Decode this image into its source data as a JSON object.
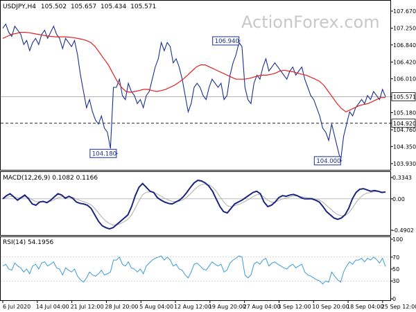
{
  "chart_data": {
    "type": "line",
    "header": {
      "symbol": "USDJPY,H4",
      "open": "105.502",
      "high": "105.657",
      "low": "105.434",
      "close": "105.571"
    },
    "watermark": "ActionForex.com",
    "colors": {
      "price": "#1a2f8f",
      "ma": "#e02020",
      "macd": "#1a237e",
      "signal": "#b0b0b0",
      "rsi": "#3a9ad9",
      "label_bg": "#ffffff",
      "label_border": "#1a2f8f",
      "grid": "#d9d9d9",
      "dash": "#222222"
    },
    "x_axis": {
      "labels": [
        "6 Jul 2020",
        "14 Jul 04:00",
        "21 Jul 12:00",
        "28 Jul 20:00",
        "5 Aug 04:00",
        "12 Aug 12:00",
        "19 Aug 20:00",
        "27 Aug 04:00",
        "3 Sep 12:00",
        "10 Sep 20:00",
        "18 Sep 04:00",
        "25 Sep 12:00"
      ],
      "label_positions": [
        0,
        12,
        24,
        36,
        48,
        60,
        72,
        84,
        96,
        108,
        120,
        132
      ]
    },
    "price_panel": {
      "ylim": [
        103.93,
        107.67
      ],
      "ticks": [
        "107.670",
        "107.250",
        "106.840",
        "106.420",
        "106.010",
        "105.571",
        "105.180",
        "104.920",
        "104.760",
        "104.350",
        "103.930"
      ],
      "tick_values": [
        107.67,
        107.25,
        106.84,
        106.42,
        106.01,
        105.571,
        105.18,
        104.92,
        104.76,
        104.35,
        103.93
      ],
      "highlight": {
        "current": "105.571",
        "level": "104.920"
      },
      "current_line": 105.571,
      "dashed_level": 104.92,
      "annotations": [
        {
          "text": "104.180",
          "x": 38,
          "y": 104.18,
          "side": "left"
        },
        {
          "text": "106.940",
          "x": 79,
          "y": 106.94,
          "side": "left"
        },
        {
          "text": "104.000",
          "x": 113,
          "y": 104.0,
          "side": "left"
        }
      ],
      "close": [
        107.25,
        107.35,
        107.15,
        107.05,
        107.3,
        107.2,
        107.1,
        106.85,
        106.95,
        106.7,
        106.9,
        107.0,
        106.85,
        107.1,
        107.2,
        107.0,
        107.15,
        107.3,
        107.1,
        107.0,
        106.75,
        107.0,
        106.9,
        106.8,
        106.95,
        106.6,
        106.1,
        105.7,
        105.3,
        105.5,
        105.2,
        105.0,
        104.9,
        105.1,
        104.8,
        104.7,
        104.3,
        105.8,
        105.8,
        106.0,
        105.6,
        105.5,
        105.9,
        105.7,
        105.6,
        105.4,
        105.5,
        105.3,
        105.6,
        105.7,
        106.0,
        106.3,
        106.5,
        106.9,
        106.7,
        106.9,
        106.8,
        106.4,
        106.5,
        106.3,
        106.0,
        105.6,
        105.2,
        105.4,
        105.8,
        105.9,
        105.8,
        105.6,
        105.5,
        105.8,
        106.0,
        105.9,
        105.8,
        105.9,
        105.5,
        105.6,
        106.1,
        106.4,
        106.6,
        106.9,
        106.8,
        105.8,
        105.5,
        105.4,
        105.9,
        106.1,
        106.0,
        106.3,
        106.5,
        106.2,
        106.3,
        106.4,
        106.3,
        106.2,
        106.1,
        106.0,
        106.2,
        106.3,
        106.1,
        106.2,
        106.3,
        106.0,
        105.8,
        105.6,
        105.5,
        105.3,
        105.1,
        104.8,
        104.7,
        104.5,
        104.9,
        104.6,
        104.3,
        104.0,
        104.6,
        104.9,
        105.2,
        105.1,
        105.3,
        105.4,
        105.5,
        105.4,
        105.6,
        105.5,
        105.7,
        105.6,
        105.5,
        105.75,
        105.571
      ],
      "ma": [
        107.0,
        107.05,
        107.1,
        107.12,
        107.15,
        107.15,
        107.14,
        107.12,
        107.1,
        107.08,
        107.06,
        107.05,
        107.04,
        107.04,
        107.04,
        107.03,
        107.02,
        107.0,
        106.98,
        106.95,
        106.9,
        106.8,
        106.65,
        106.5,
        106.35,
        106.15,
        105.95,
        105.8,
        105.7,
        105.68,
        105.7,
        105.72,
        105.75,
        105.75,
        105.72,
        105.7,
        105.72,
        105.75,
        105.8,
        105.85,
        105.92,
        106.0,
        106.1,
        106.2,
        106.3,
        106.35,
        106.35,
        106.3,
        106.25,
        106.2,
        106.15,
        106.1,
        106.05,
        106.0,
        106.0,
        106.0,
        106.02,
        106.05,
        106.08,
        106.1,
        106.1,
        106.12,
        106.15,
        106.2,
        106.22,
        106.2,
        106.18,
        106.15,
        106.12,
        106.1,
        106.05,
        106.0,
        105.95,
        105.85,
        105.7,
        105.55,
        105.4,
        105.28,
        105.2,
        105.25,
        105.3,
        105.35,
        105.38,
        105.4,
        105.45,
        105.5,
        105.55,
        105.55
      ]
    },
    "macd_panel": {
      "label": "MACD(12,26,9) 0.1082 0.1166",
      "ylim": [
        -0.4902,
        0.3343
      ],
      "ticks": [
        "0.3343",
        "0.00",
        "-0.4902"
      ],
      "tick_values": [
        0.3343,
        0.0,
        -0.4902
      ],
      "macd": [
        0.0,
        0.05,
        0.08,
        0.03,
        -0.02,
        0.02,
        0.06,
        0.0,
        -0.08,
        -0.1,
        -0.05,
        -0.04,
        -0.06,
        -0.02,
        0.03,
        0.08,
        0.06,
        0.01,
        0.04,
        0.01,
        -0.05,
        -0.07,
        -0.08,
        -0.1,
        -0.15,
        -0.25,
        -0.35,
        -0.42,
        -0.45,
        -0.47,
        -0.45,
        -0.4,
        -0.35,
        -0.3,
        -0.25,
        -0.12,
        0.05,
        0.18,
        0.24,
        0.18,
        0.12,
        0.1,
        0.02,
        -0.02,
        -0.05,
        -0.07,
        -0.08,
        -0.05,
        -0.02,
        0.03,
        0.1,
        0.18,
        0.25,
        0.29,
        0.28,
        0.25,
        0.2,
        0.12,
        0.0,
        -0.12,
        -0.2,
        -0.22,
        -0.15,
        -0.08,
        -0.05,
        -0.02,
        0.02,
        0.06,
        0.1,
        0.12,
        0.08,
        -0.05,
        -0.12,
        -0.1,
        -0.05,
        0.02,
        0.05,
        0.04,
        0.06,
        0.07,
        0.05,
        0.02,
        0.0,
        0.0,
        0.0,
        -0.02,
        -0.05,
        -0.12,
        -0.2,
        -0.25,
        -0.3,
        -0.32,
        -0.3,
        -0.25,
        -0.15,
        0.0,
        0.1,
        0.15,
        0.16,
        0.14,
        0.12,
        0.13,
        0.12,
        0.1,
        0.108
      ]
    },
    "rsi_panel": {
      "label": "RSI(14) 54.1956",
      "ylim": [
        0,
        100
      ],
      "ticks": [
        "100",
        "70",
        "50",
        "30",
        "0"
      ],
      "tick_values": [
        100,
        70,
        50,
        30,
        0
      ],
      "rsi": [
        55,
        58,
        50,
        48,
        60,
        55,
        52,
        45,
        50,
        42,
        55,
        58,
        50,
        60,
        62,
        55,
        58,
        62,
        52,
        50,
        40,
        52,
        48,
        45,
        50,
        38,
        32,
        28,
        35,
        45,
        40,
        38,
        42,
        48,
        40,
        42,
        45,
        65,
        65,
        70,
        58,
        55,
        62,
        52,
        50,
        45,
        50,
        42,
        55,
        60,
        65,
        68,
        70,
        72,
        65,
        70,
        65,
        55,
        58,
        50,
        48,
        40,
        35,
        45,
        58,
        60,
        55,
        50,
        48,
        55,
        62,
        58,
        55,
        58,
        45,
        48,
        60,
        65,
        68,
        72,
        70,
        40,
        35,
        40,
        58,
        62,
        58,
        65,
        68,
        55,
        60,
        62,
        58,
        55,
        52,
        50,
        55,
        58,
        52,
        55,
        58,
        45,
        40,
        38,
        35,
        32,
        30,
        25,
        30,
        28,
        45,
        38,
        32,
        28,
        45,
        55,
        62,
        58,
        65,
        65,
        68,
        62,
        68,
        65,
        70,
        66,
        60,
        68,
        54.2
      ]
    }
  }
}
